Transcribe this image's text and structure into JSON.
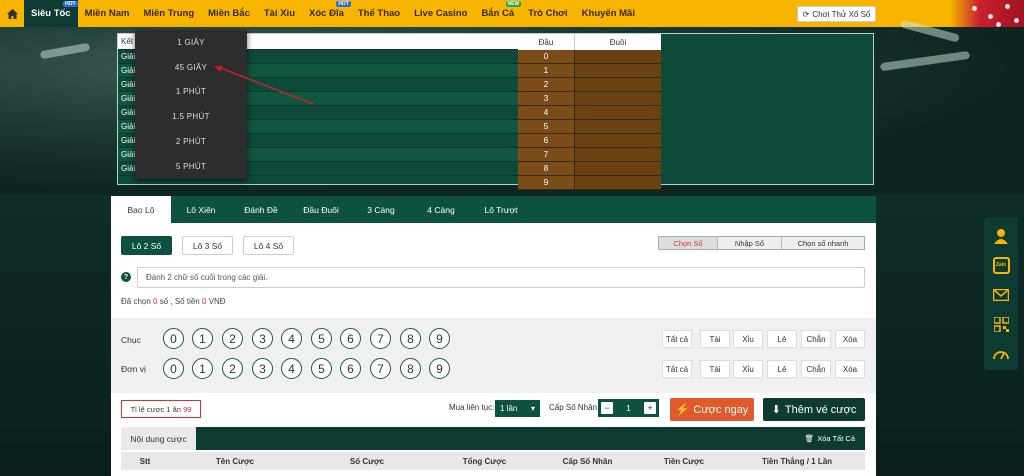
{
  "nav": {
    "home_icon": "home-icon",
    "items": [
      {
        "label": "Siêu Tốc",
        "badge": "HOT",
        "active": true
      },
      {
        "label": "Miền Nam"
      },
      {
        "label": "Miền Trung"
      },
      {
        "label": "Miền Bắc"
      },
      {
        "label": "Tài Xỉu"
      },
      {
        "label": "Xóc Đĩa",
        "badge": "HOT"
      },
      {
        "label": "Thể Thao"
      },
      {
        "label": "Live Casino"
      },
      {
        "label": "Bắn Cá",
        "badge": "NEW"
      },
      {
        "label": "Trò Chơi"
      },
      {
        "label": "Khuyến Mãi"
      }
    ],
    "demo_label": "Chơi Thử Xổ Số"
  },
  "dropdown": {
    "items": [
      "1 GIÂY",
      "45 GIÂY",
      "1 PHÚT",
      "1.5 PHÚT",
      "2 PHÚT",
      "5 PHÚT"
    ]
  },
  "results": {
    "header_left": "Kết",
    "row_label": "Giải",
    "rows": 9,
    "header_dau": "Đầu",
    "header_duoi": "Đuôi",
    "dau": [
      "0",
      "1",
      "2",
      "3",
      "4",
      "5",
      "6",
      "7",
      "8",
      "9"
    ]
  },
  "tabs": [
    "Bao Lô",
    "Lô Xiên",
    "Đánh Đề",
    "Đầu Đuôi",
    "3 Càng",
    "4 Càng",
    "Lô Trượt"
  ],
  "kinds": [
    "Lô 2 Số",
    "Lô 3 Số",
    "Lô 4 Số"
  ],
  "modes": [
    "Chọn Số",
    "Nhập Số",
    "Chọn số nhanh"
  ],
  "hint": "Đánh 2 chữ số cuối trong các giải.",
  "selinfo": {
    "prefix": "Đã chọn",
    "count": "0",
    "mid": "số , Số tiền",
    "money": "0",
    "unit": "VNĐ"
  },
  "numbers": {
    "row1_label": "Chục",
    "row2_label": "Đơn vị",
    "digits": [
      "0",
      "1",
      "2",
      "3",
      "4",
      "5",
      "6",
      "7",
      "8",
      "9"
    ],
    "quick": [
      "Tất cả",
      "Tài",
      "Xỉu",
      "Lẻ",
      "Chẵn",
      "Xóa"
    ]
  },
  "bet": {
    "rate_prefix": "Tỉ lệ cược 1 ăn",
    "rate_value": "99",
    "mua_label": "Mua liên tục:",
    "mua_value": "1 lần",
    "cap_label": "Cấp Số Nhân",
    "cap_value": "1",
    "cuoc_label": "Cược ngay",
    "them_label": "Thêm vé cược"
  },
  "content": {
    "tab_label": "Nội dung cược",
    "clear_label": "Xóa Tất Cả",
    "columns": [
      "Stt",
      "Tên Cược",
      "Số Cược",
      "Tổng Cược",
      "Cấp Số Nhân",
      "Tiền Cược",
      "Tiền Thắng / 1 Lần"
    ]
  },
  "sidebar": {
    "icons": [
      "user-support-icon",
      "zalo-icon",
      "mail-icon",
      "qr-code-icon",
      "speed-gauge-icon"
    ],
    "zalo_text": "Zalo"
  },
  "colors": {
    "nav": "#f7b500",
    "green": "#0d5240",
    "accent": "#d0352a",
    "orange": "#e05a2c"
  }
}
